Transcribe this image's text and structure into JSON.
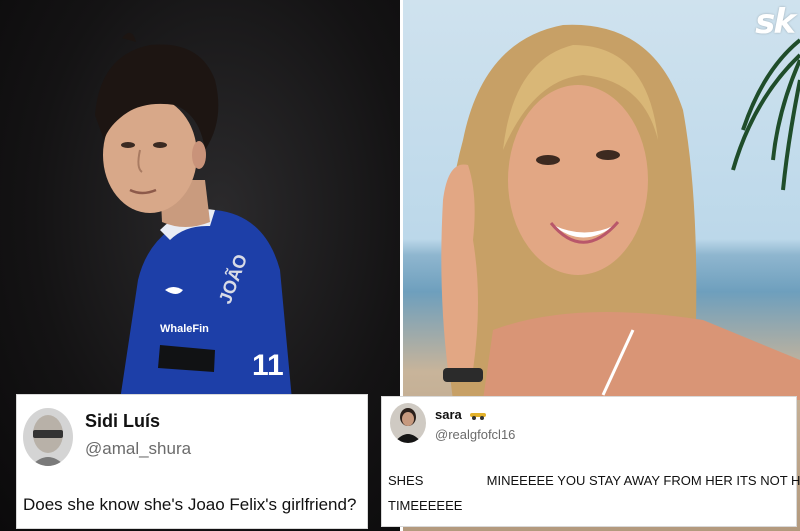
{
  "watermark": "sk",
  "tweets": [
    {
      "display_name": "Sidi Luís",
      "handle": "@amal_shura",
      "text": "Does she know she's Joao Felix's girlfriend?"
    },
    {
      "display_name": "sara",
      "name_emoji": "racing-car-emoji",
      "handle": "@realgfofcl16",
      "text_part1": "SHES",
      "text_part2": "MINEEEEE YOU STAY AWAY FROM HER ITS NOT HER",
      "text_line2": "TIMEEEEEE"
    }
  ],
  "colors": {
    "jersey": "#1d3fa8",
    "card_border": "#d9d9d9",
    "handle_gray": "#6b6b6b"
  }
}
